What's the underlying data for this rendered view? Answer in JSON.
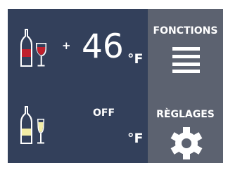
{
  "zones": {
    "top": {
      "wine_icon": "red-wine-bottle-and-glass-icon",
      "sign": "+",
      "temperature": "46",
      "unit": "°F"
    },
    "bottom": {
      "wine_icon": "white-wine-bottle-and-flute-icon",
      "status": "OFF",
      "unit": "°F"
    }
  },
  "menu": {
    "functions": {
      "label": "FONCTIONS",
      "icon": "hamburger-menu-icon"
    },
    "settings": {
      "label": "RÈGLAGES",
      "icon": "gear-icon"
    }
  },
  "colors": {
    "panel": "#33405b",
    "sidebar": "#5c6270",
    "text": "#ffffff",
    "red_wine": "#c0202c",
    "white_wine": "#f3eda6"
  }
}
